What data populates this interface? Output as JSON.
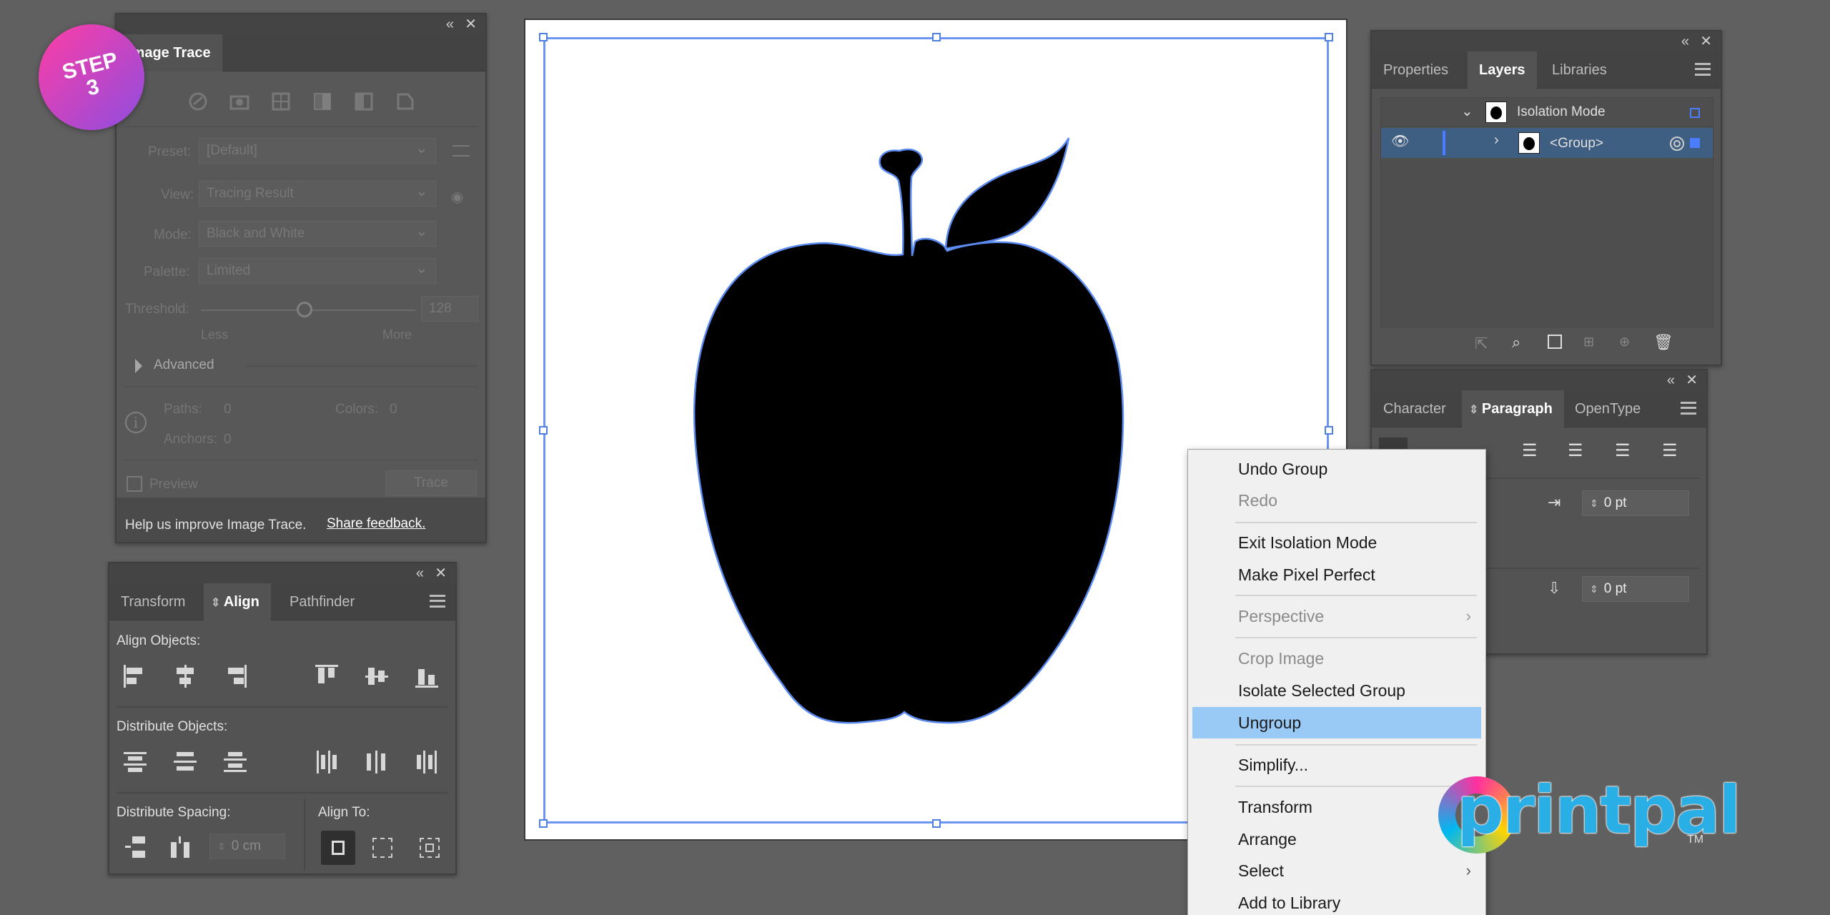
{
  "step_badge": {
    "line1": "STEP",
    "line2": "3"
  },
  "image_trace": {
    "tab_label": "Image Trace",
    "preset_label": "Preset:",
    "preset_value": "[Default]",
    "view_label": "View:",
    "view_value": "Tracing Result",
    "mode_label": "Mode:",
    "mode_value": "Black and White",
    "palette_label": "Palette:",
    "palette_value": "Limited",
    "threshold_label": "Threshold:",
    "threshold_value": "128",
    "threshold_level": 0.5,
    "less_label": "Less",
    "more_label": "More",
    "advanced_label": "Advanced",
    "paths_label": "Paths:",
    "paths_value": "0",
    "colors_label": "Colors:",
    "colors_value": "0",
    "anchors_label": "Anchors:",
    "anchors_value": "0",
    "preview_label": "Preview",
    "trace_button": "Trace",
    "help_text": "Help us improve Image Trace.",
    "feedback_link": "Share feedback."
  },
  "align_panel": {
    "tabs": [
      "Transform",
      "Align",
      "Pathfinder"
    ],
    "align_objects_label": "Align Objects:",
    "distribute_objects_label": "Distribute Objects:",
    "distribute_spacing_label": "Distribute Spacing:",
    "align_to_label": "Align To:",
    "spacing_value": "0 cm"
  },
  "layers_panel": {
    "tabs": [
      "Properties",
      "Layers",
      "Libraries"
    ],
    "rows": [
      {
        "name": "Isolation Mode"
      },
      {
        "name": "<Group>"
      }
    ],
    "colors": {
      "selected_row": "#3f5f82",
      "marker": "#4a7dff"
    }
  },
  "paragraph_panel": {
    "tabs": [
      "Character",
      "Paragraph",
      "OpenType"
    ],
    "indent_value": "0 pt",
    "space_value": "0 pt"
  },
  "context_menu": {
    "items": [
      {
        "label": "Undo Group",
        "disabled": false
      },
      {
        "label": "Redo",
        "disabled": true
      },
      {
        "label": "Exit Isolation Mode",
        "disabled": false
      },
      {
        "label": "Make Pixel Perfect",
        "disabled": false
      },
      {
        "label": "Perspective",
        "disabled": true
      },
      {
        "label": "Crop Image",
        "disabled": true
      },
      {
        "label": "Isolate Selected Group",
        "disabled": false
      },
      {
        "label": "Ungroup",
        "disabled": false,
        "highlighted": true
      },
      {
        "label": "Simplify...",
        "disabled": false
      },
      {
        "label": "Transform",
        "disabled": false
      },
      {
        "label": "Arrange",
        "disabled": false
      },
      {
        "label": "Select",
        "disabled": false
      },
      {
        "label": "Add to Library",
        "disabled": false
      }
    ],
    "highlight_color": "#99c9f5"
  },
  "logo": {
    "text": "printpal",
    "tm": "TM"
  },
  "colors": {
    "workspace": "#606060",
    "selection": "#4f7fe0",
    "badge_from": "#ff3da5",
    "badge_to": "#8d4de0"
  }
}
